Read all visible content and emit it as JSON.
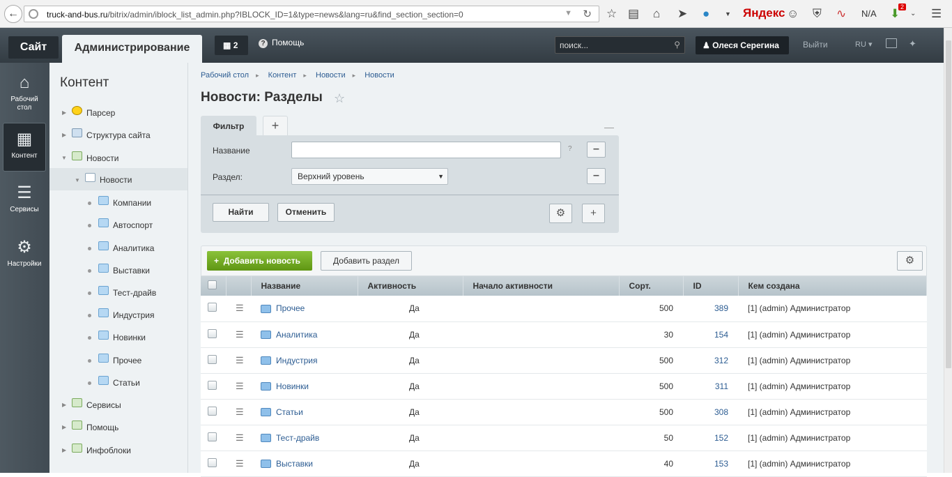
{
  "browser": {
    "url_host": "truck-and-bus.ru",
    "url_path": "/bitrix/admin/iblock_list_admin.php?IBLOCK_ID=1&type=news&lang=ru&find_section_section=0",
    "yandex": "Яндекс",
    "na": "N/A",
    "badge": "2"
  },
  "topbar": {
    "site_tab": "Сайт",
    "admin_tab": "Администрирование",
    "notif_count": "2",
    "help": "Помощь",
    "search_placeholder": "поиск...",
    "user": "Олеся Серегина",
    "logout": "Выйти",
    "lang": "RU"
  },
  "left_menu": [
    {
      "label": "Рабочий стол"
    },
    {
      "label": "Контент"
    },
    {
      "label": "Сервисы"
    },
    {
      "label": "Настройки"
    }
  ],
  "tree": {
    "title": "Контент",
    "items": [
      {
        "label": "Парсер"
      },
      {
        "label": "Структура сайта"
      },
      {
        "label": "Новости"
      },
      {
        "label": "Новости"
      },
      {
        "label": "Компании"
      },
      {
        "label": "Автоспорт"
      },
      {
        "label": "Аналитика"
      },
      {
        "label": "Выставки"
      },
      {
        "label": "Тест-драйв"
      },
      {
        "label": "Индустрия"
      },
      {
        "label": "Новинки"
      },
      {
        "label": "Прочее"
      },
      {
        "label": "Статьи"
      },
      {
        "label": "Сервисы"
      },
      {
        "label": "Помощь"
      },
      {
        "label": "Инфоблоки"
      }
    ]
  },
  "breadcrumbs": [
    "Рабочий стол",
    "Контент",
    "Новости",
    "Новости"
  ],
  "page_title": "Новости: Разделы",
  "filter": {
    "tab": "Фильтр",
    "name_label": "Название",
    "name_value": "",
    "section_label": "Раздел:",
    "section_value": "Верхний уровень",
    "find": "Найти",
    "cancel": "Отменить"
  },
  "list": {
    "add_news": "Добавить новость",
    "add_section": "Добавить раздел",
    "columns": [
      "Название",
      "Активность",
      "Начало активности",
      "Сорт.",
      "ID",
      "Кем создана"
    ],
    "rows": [
      {
        "name": "Прочее",
        "active": "Да",
        "start": "",
        "sort": "500",
        "id": "389",
        "author": "[1] (admin) Администратор"
      },
      {
        "name": "Аналитика",
        "active": "Да",
        "start": "",
        "sort": "30",
        "id": "154",
        "author": "[1] (admin) Администратор"
      },
      {
        "name": "Индустрия",
        "active": "Да",
        "start": "",
        "sort": "500",
        "id": "312",
        "author": "[1] (admin) Администратор"
      },
      {
        "name": "Новинки",
        "active": "Да",
        "start": "",
        "sort": "500",
        "id": "311",
        "author": "[1] (admin) Администратор"
      },
      {
        "name": "Статьи",
        "active": "Да",
        "start": "",
        "sort": "500",
        "id": "308",
        "author": "[1] (admin) Администратор"
      },
      {
        "name": "Тест-драйв",
        "active": "Да",
        "start": "",
        "sort": "50",
        "id": "152",
        "author": "[1] (admin) Администратор"
      },
      {
        "name": "Выставки",
        "active": "Да",
        "start": "",
        "sort": "40",
        "id": "153",
        "author": "[1] (admin) Администратор"
      }
    ]
  }
}
